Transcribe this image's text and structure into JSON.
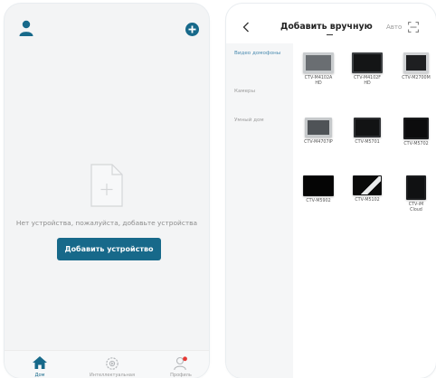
{
  "left_screen": {
    "empty_message": "Нет устройства, пожалуйста, добавьте устройства",
    "add_device_label": "Добавить устройство",
    "tabs": [
      {
        "label": "Дом",
        "icon": "home-icon",
        "active": true
      },
      {
        "label": "Интеллектуальная",
        "icon": "scene-gear-icon",
        "active": false
      },
      {
        "label": "Профиль",
        "icon": "profile-icon",
        "active": false
      }
    ]
  },
  "right_screen": {
    "title": "Добавить вручную",
    "auto_label": "Авто",
    "categories": [
      {
        "label": "Видео домофоны",
        "active": true
      },
      {
        "label": "Камеры",
        "active": false
      },
      {
        "label": "Умный дом",
        "active": false
      }
    ],
    "devices": [
      {
        "name": "CTV-M4102A\nHD",
        "style": "silver-wide"
      },
      {
        "name": "CTV-M4102F\nHD",
        "style": "dark-wide"
      },
      {
        "name": "CTV-M2700M",
        "style": "silver-frame"
      },
      {
        "name": "CTV-M4707IP",
        "style": "silver-small"
      },
      {
        "name": "CTV-M5701",
        "style": "dark-small"
      },
      {
        "name": "CTV-M5702",
        "style": "black-frame"
      },
      {
        "name": "CTV-M5902",
        "style": "black-glossy"
      },
      {
        "name": "CTV-M5102",
        "style": "black-diagonal"
      },
      {
        "name": "CTV-iM\nCloud",
        "style": "black-portrait"
      }
    ]
  },
  "colors": {
    "accent": "#17698a",
    "active_category": "#4a8bb0",
    "notification_dot": "#e53935"
  }
}
